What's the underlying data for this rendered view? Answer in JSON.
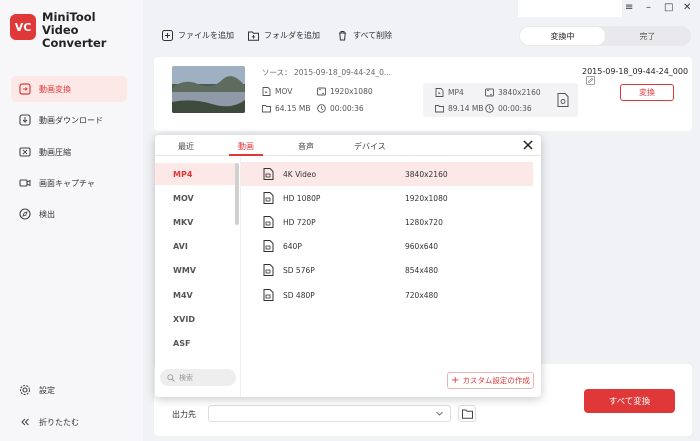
{
  "app": {
    "logo_text": "VC",
    "brand_line1": "MiniTool",
    "brand_line2": "Video Converter",
    "accent": "#e03838"
  },
  "sidebar": {
    "items": [
      {
        "label": "動画変換",
        "icon": "video-convert-icon",
        "active": true
      },
      {
        "label": "動画ダウンロード",
        "icon": "download-icon",
        "active": false
      },
      {
        "label": "動画圧縮",
        "icon": "compress-icon",
        "active": false
      },
      {
        "label": "画面キャプチャ",
        "icon": "camera-icon",
        "active": false
      },
      {
        "label": "検出",
        "icon": "compass-icon",
        "active": false
      }
    ],
    "settings_label": "設定",
    "collapse_label": "折りたたむ"
  },
  "window": {
    "minimize": "–",
    "maximize": "□",
    "close": "✕",
    "menu": "≡"
  },
  "toolbar": {
    "add_file": "ファイルを追加",
    "add_folder": "フォルダを追加",
    "delete_all": "すべて削除",
    "tab_converting": "変換中",
    "tab_done": "完了"
  },
  "file": {
    "source_label": "ソース：",
    "source_name": "2015-09-18_09-44-24_0...",
    "src_format": "MOV",
    "src_resolution": "1920x1080",
    "src_size": "64.15 MB",
    "src_duration": "00:00:36",
    "out_name": "2015-09-18_09-44-24_000",
    "out_format": "MP4",
    "out_resolution": "3840x2160",
    "out_size": "89.14 MB",
    "out_duration": "00:00:36",
    "convert_label": "変換"
  },
  "popup": {
    "tabs": [
      "最近",
      "動画",
      "音声",
      "デバイス"
    ],
    "active_tab": 1,
    "formats": [
      "MP4",
      "MOV",
      "MKV",
      "AVI",
      "WMV",
      "M4V",
      "XVID",
      "ASF"
    ],
    "active_format": 0,
    "search_placeholder": "検索",
    "presets": [
      {
        "name": "4K Video",
        "res": "3840x2160"
      },
      {
        "name": "HD 1080P",
        "res": "1920x1080"
      },
      {
        "name": "HD 720P",
        "res": "1280x720"
      },
      {
        "name": "640P",
        "res": "960x640"
      },
      {
        "name": "SD 576P",
        "res": "854x480"
      },
      {
        "name": "SD 480P",
        "res": "720x480"
      }
    ],
    "active_preset": 0,
    "custom_label": "カスタム設定の作成"
  },
  "bottom": {
    "output_label": "出力先",
    "output_value": "",
    "convert_all": "すべて変換"
  }
}
